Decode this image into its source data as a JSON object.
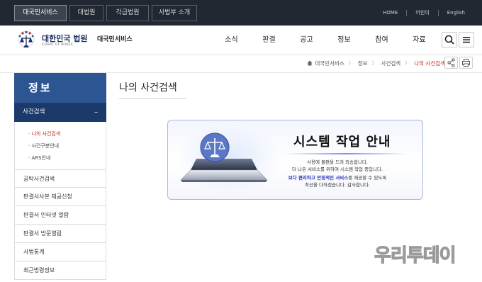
{
  "topbar": {
    "site_tabs": [
      {
        "label": "대국민서비스",
        "active": true
      },
      {
        "label": "대법원",
        "active": false
      },
      {
        "label": "각급법원",
        "active": false
      },
      {
        "label": "사법부 소개",
        "active": false
      }
    ],
    "links": [
      "HOME",
      "어린이",
      "English"
    ]
  },
  "header": {
    "logo_title": "대한민국 법원",
    "logo_subtitle": "COURT OF KOREA",
    "service_name": "대국민서비스",
    "gnb": [
      "소식",
      "판결",
      "공고",
      "정보",
      "참여",
      "자료"
    ],
    "search_icon": "search-icon",
    "menu_icon": "hamburger-menu-icon"
  },
  "breadcrumb": {
    "home_icon": "home-icon",
    "items": [
      "대국민서비스",
      "정보",
      "사건검색",
      "나의 사건검색"
    ],
    "share_icon": "share-icon",
    "print_icon": "print-icon"
  },
  "lnb": {
    "title": "정보",
    "active_section": "사건검색",
    "collapse_symbol": "–",
    "sub_items": [
      {
        "label": "· 나의 사건검색",
        "on": true
      },
      {
        "label": "· 사건구분안내",
        "on": false
      },
      {
        "label": "· ARS안내",
        "on": false
      }
    ],
    "items": [
      "공탁사건검색",
      "판결서사본 제공신청",
      "판결서 인터넷 열람",
      "판결서 방문열람",
      "사법통계",
      "최근법령정보"
    ]
  },
  "content": {
    "page_title": "나의 사건검색"
  },
  "notice": {
    "title": "시스템 작업 안내",
    "line1": "사용에 불편을 드려 죄송합니다.",
    "line2": "더 나은 서비스를 위하여 시스템 작업 중입니다.",
    "line3_highlight": "보다 편리하고 안정적인 서비스",
    "line3_rest": "를 제공할 수 있도록",
    "line4": "최선을 다하겠습니다. 감사합니다."
  },
  "watermark": "우리투데이",
  "colors": {
    "topbar": "#222831",
    "lnb_title": "#2c5591",
    "lnb_active": "#1b3a6a",
    "accent_red": "#c8231d"
  }
}
